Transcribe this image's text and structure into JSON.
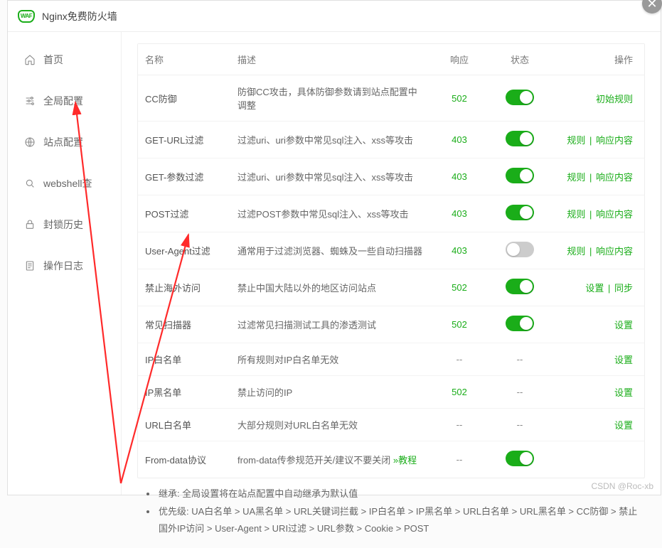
{
  "title": "Nginx免费防火墙",
  "close_glyph": "✕",
  "sidebar": {
    "items": [
      {
        "label": "首页"
      },
      {
        "label": "全局配置"
      },
      {
        "label": "站点配置"
      },
      {
        "label": "webshell查"
      },
      {
        "label": "封锁历史"
      },
      {
        "label": "操作日志"
      }
    ]
  },
  "table": {
    "headers": {
      "name": "名称",
      "desc": "描述",
      "resp": "响应",
      "state": "状态",
      "ops": "操作"
    },
    "rows": [
      {
        "name": "CC防御",
        "desc": "防御CC攻击，具体防御参数请到站点配置中调整",
        "resp": "502",
        "state": "on",
        "ops": [
          {
            "text": "初始规则"
          }
        ]
      },
      {
        "name": "GET-URL过滤",
        "desc": "过滤uri、uri参数中常见sql注入、xss等攻击",
        "resp": "403",
        "state": "on",
        "ops": [
          {
            "text": "规则"
          },
          {
            "text": "响应内容"
          }
        ]
      },
      {
        "name": "GET-参数过滤",
        "desc": "过滤uri、uri参数中常见sql注入、xss等攻击",
        "resp": "403",
        "state": "on",
        "ops": [
          {
            "text": "规则"
          },
          {
            "text": "响应内容"
          }
        ]
      },
      {
        "name": "POST过滤",
        "desc": "过滤POST参数中常见sql注入、xss等攻击",
        "resp": "403",
        "state": "on",
        "ops": [
          {
            "text": "规则"
          },
          {
            "text": "响应内容"
          }
        ]
      },
      {
        "name": "User-Agent过滤",
        "desc": "通常用于过滤浏览器、蜘蛛及一些自动扫描器",
        "resp": "403",
        "state": "off",
        "ops": [
          {
            "text": "规则"
          },
          {
            "text": "响应内容"
          }
        ]
      },
      {
        "name": "禁止海外访问",
        "desc": "禁止中国大陆以外的地区访问站点",
        "resp": "502",
        "state": "on",
        "ops": [
          {
            "text": "设置"
          },
          {
            "text": "同步"
          }
        ]
      },
      {
        "name": "常见扫描器",
        "desc": "过滤常见扫描测试工具的渗透测试",
        "resp": "502",
        "state": "on",
        "ops": [
          {
            "text": "设置"
          }
        ]
      },
      {
        "name": "IP白名单",
        "desc": "所有规则对IP白名单无效",
        "resp": "--",
        "state": "none",
        "ops": [
          {
            "text": "设置"
          }
        ]
      },
      {
        "name": "IP黑名单",
        "desc": "禁止访问的IP",
        "resp": "502",
        "state": "none",
        "ops": [
          {
            "text": "设置"
          }
        ]
      },
      {
        "name": "URL白名单",
        "desc": "大部分规则对URL白名单无效",
        "resp": "--",
        "state": "none",
        "ops": [
          {
            "text": "设置"
          }
        ]
      },
      {
        "name": "From-data协议",
        "desc": "from-data传参规范开关/建议不要关闭 ",
        "desc_link": "»教程",
        "resp": "--",
        "state": "on",
        "ops": []
      }
    ]
  },
  "footer": {
    "line1": "继承: 全局设置将在站点配置中自动继承为默认值",
    "line2": "优先级: UA白名单 > UA黑名单 > URL关键词拦截 > IP白名单 > IP黑名单 > URL白名单 > URL黑名单 > CC防御 > 禁止国外IP访问 > User-Agent > URI过滤 > URL参数 > Cookie > POST"
  },
  "watermark": "CSDN @Roc-xb"
}
